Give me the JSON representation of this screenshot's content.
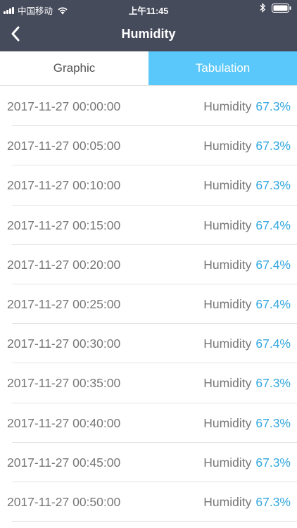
{
  "status_bar": {
    "carrier": "中国移动",
    "time": "上午11:45"
  },
  "nav": {
    "title": "Humidity"
  },
  "tabs": [
    {
      "label": "Graphic",
      "active": false
    },
    {
      "label": "Tabulation",
      "active": true
    }
  ],
  "colors": {
    "header_bg": "#464b5b",
    "accent": "#5ac8fa",
    "value_text": "#35a8e0"
  },
  "rows": [
    {
      "time": "2017-11-27 00:00:00",
      "label": "Humidity",
      "value": "67.3%"
    },
    {
      "time": "2017-11-27 00:05:00",
      "label": "Humidity",
      "value": "67.3%"
    },
    {
      "time": "2017-11-27 00:10:00",
      "label": "Humidity",
      "value": "67.3%"
    },
    {
      "time": "2017-11-27 00:15:00",
      "label": "Humidity",
      "value": "67.4%"
    },
    {
      "time": "2017-11-27 00:20:00",
      "label": "Humidity",
      "value": "67.4%"
    },
    {
      "time": "2017-11-27 00:25:00",
      "label": "Humidity",
      "value": "67.4%"
    },
    {
      "time": "2017-11-27 00:30:00",
      "label": "Humidity",
      "value": "67.4%"
    },
    {
      "time": "2017-11-27 00:35:00",
      "label": "Humidity",
      "value": "67.3%"
    },
    {
      "time": "2017-11-27 00:40:00",
      "label": "Humidity",
      "value": "67.3%"
    },
    {
      "time": "2017-11-27 00:45:00",
      "label": "Humidity",
      "value": "67.3%"
    },
    {
      "time": "2017-11-27 00:50:00",
      "label": "Humidity",
      "value": "67.3%"
    }
  ]
}
